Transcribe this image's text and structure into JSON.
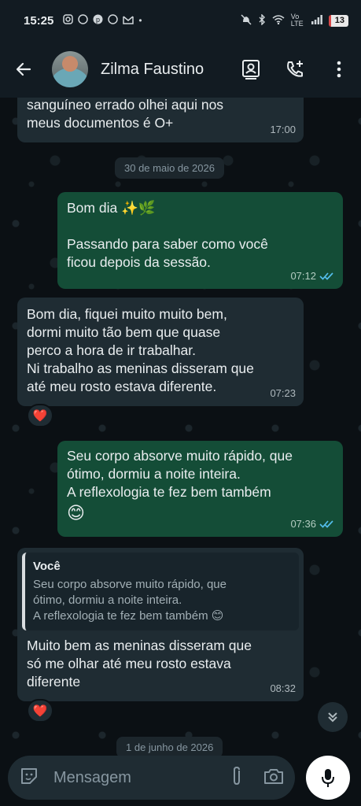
{
  "status": {
    "time": "15:25",
    "battery": "13",
    "net": "Vo LTE"
  },
  "header": {
    "contact_name": "Zilma Faustino"
  },
  "messages": {
    "m0": {
      "line1": "sanguíneo errado olhei aqui nos",
      "line2": "meus documentos é O+",
      "time": "17:00"
    },
    "date1": "30 de maio de 2026",
    "m1": {
      "line1": "Bom dia ✨🌿",
      "line2": "Passando para saber como você",
      "line3": "ficou depois da sessão.",
      "time": "07:12"
    },
    "m2": {
      "line1": "Bom dia, fiquei muito muito bem,",
      "line2": "dormi muito tão bem que quase",
      "line3": "perco a hora de ir trabalhar.",
      "line4": "Ni trabalho as meninas disseram que",
      "line5": "até meu rosto estava diferente.",
      "time": "07:23",
      "reaction": "❤️"
    },
    "m3": {
      "line1": "Seu corpo absorve muito rápido, que",
      "line2": "ótimo,  dormiu a noite inteira.",
      "line3": "A reflexologia te fez bem também",
      "line4": "😊",
      "time": "07:36"
    },
    "m4": {
      "quote_author": "Você",
      "quote_line1": "Seu corpo absorve muito rápido, que",
      "quote_line2": "ótimo,  dormiu a noite inteira.",
      "quote_line3": "A reflexologia te fez bem também 😊",
      "line1": "Muito bem as meninas disseram que",
      "line2": "só me olhar até meu rosto estava",
      "line3": "diferente",
      "time": "08:32",
      "reaction": "❤️"
    },
    "date2": "1 de junho de 2026"
  },
  "input": {
    "placeholder": "Mensagem"
  },
  "colors": {
    "incoming": "#1f2c33",
    "outgoing": "#144d37",
    "read_ticks": "#53bdeb",
    "background": "#0b1014"
  }
}
